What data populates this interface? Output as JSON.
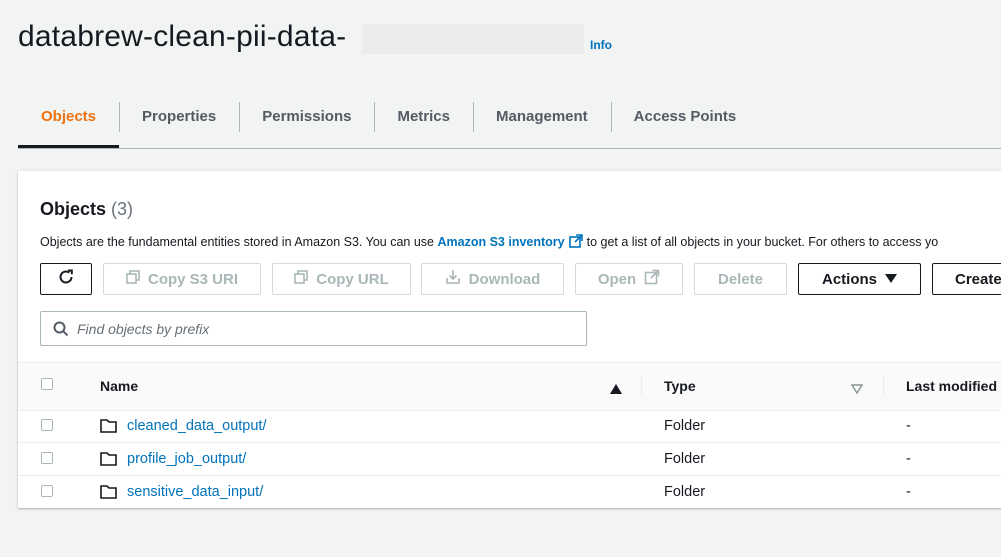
{
  "header": {
    "bucket_name": "databrew-clean-pii-data-",
    "info_label": "Info"
  },
  "tabs": [
    {
      "label": "Objects",
      "active": true
    },
    {
      "label": "Properties"
    },
    {
      "label": "Permissions"
    },
    {
      "label": "Metrics"
    },
    {
      "label": "Management"
    },
    {
      "label": "Access Points"
    }
  ],
  "objects": {
    "title": "Objects",
    "count": "(3)",
    "description_before": "Objects are the fundamental entities stored in Amazon S3. You can use",
    "inventory_link": "Amazon S3 inventory",
    "description_after": "to get a list of all objects in your bucket. For others to access yo"
  },
  "toolbar": {
    "copy_s3_uri": "Copy S3 URI",
    "copy_url": "Copy URL",
    "download": "Download",
    "open": "Open",
    "delete": "Delete",
    "actions": "Actions",
    "create": "Create"
  },
  "search": {
    "placeholder": "Find objects by prefix",
    "value": ""
  },
  "table": {
    "columns": {
      "name": "Name",
      "type": "Type",
      "last_modified": "Last modified"
    },
    "rows": [
      {
        "name": "cleaned_data_output/",
        "type": "Folder",
        "last_modified": "-"
      },
      {
        "name": "profile_job_output/",
        "type": "Folder",
        "last_modified": "-"
      },
      {
        "name": "sensitive_data_input/",
        "type": "Folder",
        "last_modified": "-"
      }
    ]
  },
  "colors": {
    "accent_orange": "#ec7211",
    "link_blue": "#0073bb",
    "text_dark": "#16191f",
    "disabled": "#aab7b8"
  }
}
